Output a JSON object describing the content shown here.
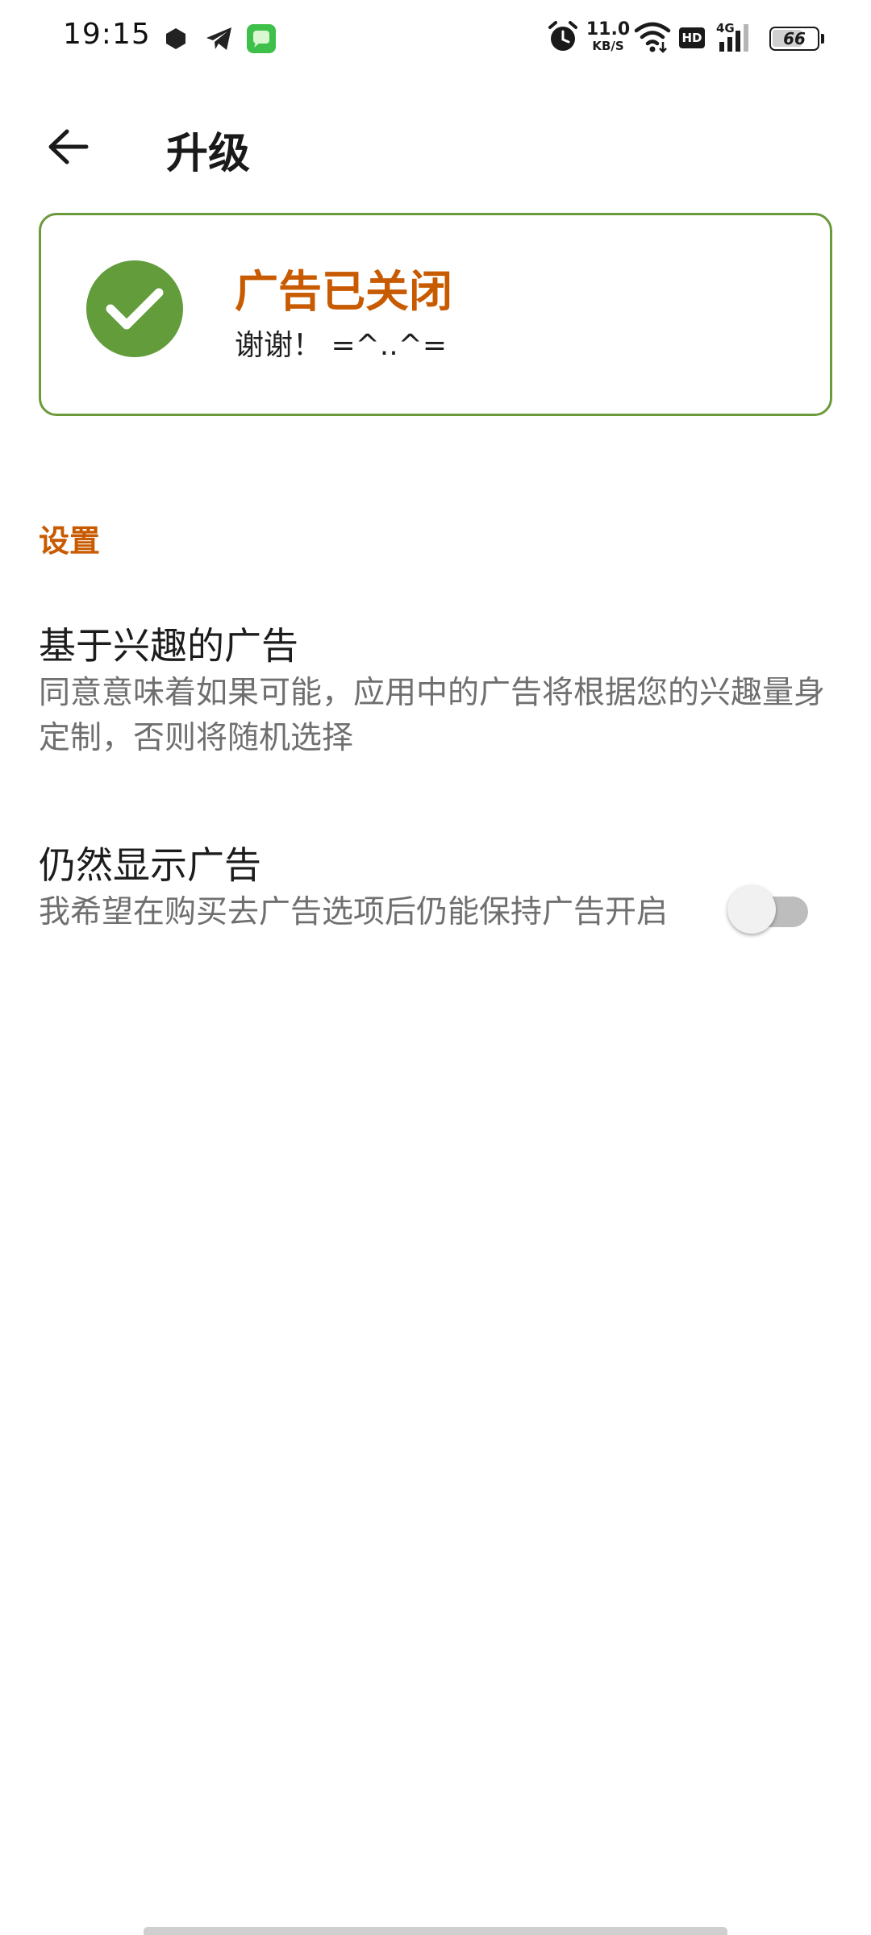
{
  "status_bar": {
    "time": "19:15",
    "net_speed_value": "11.0",
    "net_speed_unit": "KB/S",
    "hd_label": "HD",
    "signal_label": "4G",
    "battery_level": "66",
    "icons": [
      "hexagon-app-icon",
      "telegram-icon",
      "messages-app-icon",
      "alarm-icon",
      "wifi-icon",
      "hd-voice-icon",
      "signal-icon",
      "battery-icon"
    ]
  },
  "app_bar": {
    "title": "升级",
    "back_icon": "arrow-left-icon"
  },
  "card": {
    "title": "广告已关闭",
    "subtitle": "谢谢！ =^..^=",
    "icon": "check-circle-icon"
  },
  "settings": {
    "section_title": "设置",
    "items": [
      {
        "title": "基于兴趣的广告",
        "summary": "同意意味着如果可能，应用中的广告将根据您的兴趣量身定制，否则将随机选择"
      },
      {
        "title": "仍然显示广告",
        "summary": "我希望在购买去广告选项后仍能保持广告开启",
        "toggle_on": false
      }
    ]
  },
  "colors": {
    "accent": "#c85a00",
    "success": "#629c3b",
    "card_border": "#6b9a3a",
    "secondary_text": "#6f6f6f"
  }
}
